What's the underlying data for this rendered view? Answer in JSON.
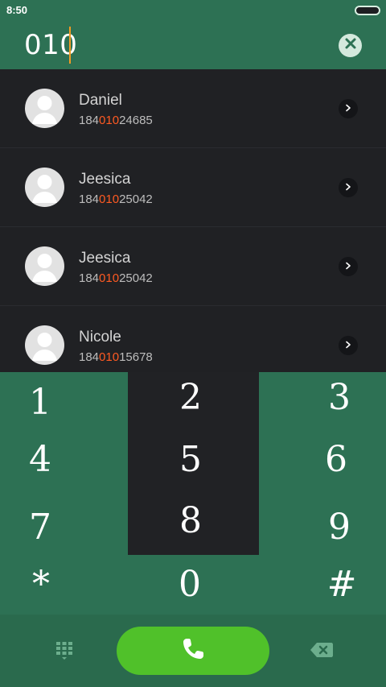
{
  "status_bar": {
    "time": "8:50"
  },
  "dialer": {
    "query": "010",
    "clear_icon": "close-icon"
  },
  "results": [
    {
      "name": "Daniel",
      "number_prefix": "184",
      "number_match": "010",
      "number_suffix": "24685",
      "avatar_icon": "person-icon",
      "action_icon": "chevron-right-icon"
    },
    {
      "name": "Jeesica",
      "number_prefix": "184",
      "number_match": "010",
      "number_suffix": "25042",
      "avatar_icon": "person-icon",
      "action_icon": "chevron-right-icon"
    },
    {
      "name": "Jeesica",
      "number_prefix": "184",
      "number_match": "010",
      "number_suffix": "25042",
      "avatar_icon": "person-icon",
      "action_icon": "chevron-right-icon"
    },
    {
      "name": "Nicole",
      "number_prefix": "184",
      "number_match": "010",
      "number_suffix": "15678",
      "avatar_icon": "person-icon",
      "action_icon": "chevron-right-icon"
    }
  ],
  "keypad": {
    "keys": [
      "1",
      "2",
      "3",
      "4",
      "5",
      "6",
      "7",
      "8",
      "9",
      "*",
      "0",
      "#"
    ]
  },
  "action_bar": {
    "dialpad_icon": "dialpad-icon",
    "call_icon": "phone-icon",
    "backspace_icon": "backspace-icon"
  },
  "colors": {
    "primary_green": "#2d7154",
    "dark_bg": "#202124",
    "highlight": "#ff5a22",
    "call_green": "#50c12a",
    "caret": "#f19b24"
  }
}
